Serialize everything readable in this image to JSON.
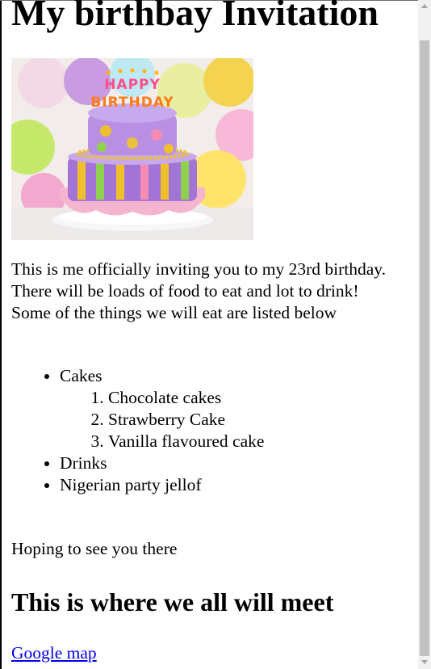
{
  "page": {
    "title": "My birthbay Invitation",
    "hero_image": {
      "icon": "birthday-cake-image",
      "topper_text": "HAPPY BIRTHDAY"
    },
    "intro_line1": "This is me officially inviting you to my 23rd birthday. There will be loads of food to eat and lot to drink!",
    "intro_line2": "Some of the things we will eat are listed below",
    "menu": [
      {
        "label": "Cakes",
        "sub": [
          "Chocolate cakes",
          "Strawberry Cake",
          "Vanilla flavoured cake"
        ]
      },
      {
        "label": "Drinks"
      },
      {
        "label": "Nigerian party jellof"
      }
    ],
    "closing": "Hoping to see you there",
    "meet_heading": "This is where we all will meet",
    "map_link": "Google map"
  },
  "colors": {
    "link": "#0000ee",
    "scrollbar_track": "#f1f1f1",
    "scrollbar_thumb": "#c1c1c1"
  }
}
